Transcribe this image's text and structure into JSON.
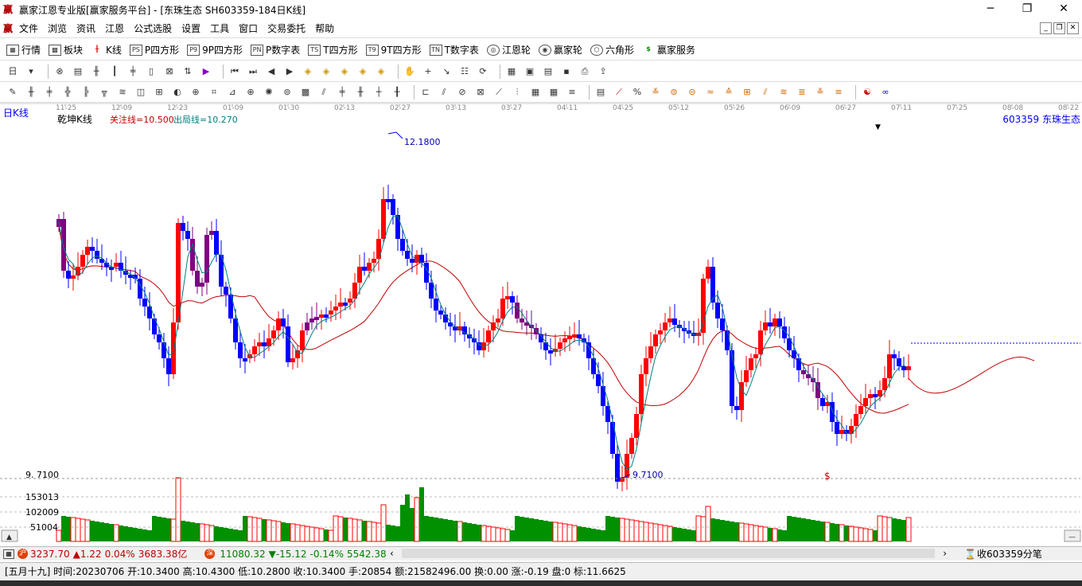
{
  "window": {
    "title": "赢家江恩专业版[赢家服务平台] - [东珠生态  SH603359-184日K线]",
    "min": "─",
    "max": "❐",
    "close": "✕"
  },
  "menu": {
    "items": [
      "文件",
      "浏览",
      "资讯",
      "江恩",
      "公式选股",
      "设置",
      "工具",
      "窗口",
      "交易委托",
      "帮助"
    ]
  },
  "toolbar": {
    "items": [
      {
        "icon": "table-icon",
        "label": "行情"
      },
      {
        "icon": "grid-icon",
        "label": "板块"
      },
      {
        "icon": "kline-icon",
        "label": "K线"
      },
      {
        "icon": "p-square-icon",
        "label": "P四方形"
      },
      {
        "icon": "9p-square-icon",
        "label": "9P四方形"
      },
      {
        "icon": "p-number-icon",
        "label": "P数字表"
      },
      {
        "icon": "t-square-icon",
        "label": "T四方形"
      },
      {
        "icon": "9t-square-icon",
        "label": "9T四方形"
      },
      {
        "icon": "t-number-icon",
        "label": "T数字表"
      },
      {
        "icon": "gann-wheel-icon",
        "label": "江恩轮"
      },
      {
        "icon": "winner-wheel-icon",
        "label": "赢家轮"
      },
      {
        "icon": "hexagon-icon",
        "label": "六角形"
      },
      {
        "icon": "dollar-icon",
        "label": "赢家服务"
      }
    ]
  },
  "chart": {
    "period_label": "日K线",
    "indicator_name": "乾坤K线",
    "focus_line": "关注线=10.500",
    "exit_line": "出局线=10.270",
    "stock_tag": "603359  东珠生态",
    "high_label": "12.1800",
    "low_label": "9.7100",
    "bottom_price": "9. 7100",
    "dollar_mark": "$",
    "vol_ticks": [
      "153013",
      "102009",
      "51004"
    ],
    "dates": [
      "11-25",
      "12-09",
      "12-23",
      "01-09",
      "01-30",
      "02-13",
      "02-27",
      "03-13",
      "03-27",
      "04-11",
      "04-25",
      "05-12",
      "05-26",
      "06-09",
      "06-27",
      "07-11",
      "07-25",
      "08-08",
      "08-22"
    ],
    "colors": {
      "up": "#ff0000",
      "down": "#0000ff",
      "purple": "#800080",
      "fast_ma": "#008080",
      "slow_ma": "#c00000",
      "vol_up": "#ff0000",
      "vol_down": "#009000"
    }
  },
  "chart_data": {
    "type": "candlestick",
    "title": "",
    "x_tick_labels": [
      "11-25",
      "12-09",
      "12-23",
      "01-09",
      "01-30",
      "02-13",
      "02-27",
      "03-13",
      "03-27",
      "04-11",
      "04-25",
      "05-12",
      "05-26",
      "06-09",
      "06-27",
      "07-11",
      "07-25",
      "08-08",
      "08-22"
    ],
    "y_range": [
      9.71,
      12.18
    ],
    "annotations": [
      "12.1800",
      "9.7100"
    ],
    "volume_ticks": [
      153013,
      102009,
      51004
    ],
    "last_bar": {
      "open": 10.34,
      "high": 10.43,
      "low": 10.28,
      "close": 10.34,
      "volume": 20854
    }
  },
  "status": {
    "sh_index": "3237.70",
    "sh_change": "▲1.22",
    "sh_pct": "0.04%",
    "sh_amount": "3683.38亿",
    "sz_index": "11080.32",
    "sz_change": "▼-15.12",
    "sz_pct": "-0.14%",
    "sz_amount": "5542.38",
    "tick_label": "收603359分笔"
  },
  "info": {
    "text": "[五月十九] 时间:20230706 开:10.3400 高:10.4300 低:10.2800 收:10.3400 手:20854 额:21582496.00 换:0.00 涨:-0.19 盘:0 标:11.6625"
  }
}
